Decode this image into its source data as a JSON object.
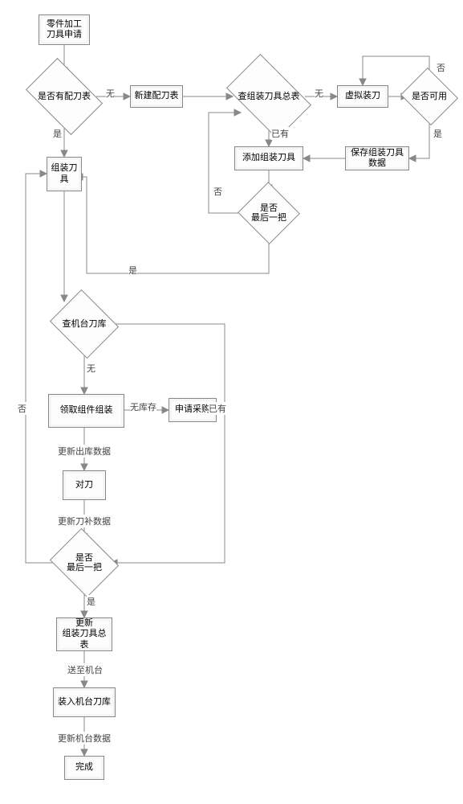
{
  "chart_data": {
    "type": "flowchart",
    "title": "",
    "nodes": [
      {
        "id": "n1",
        "type": "process",
        "label": "零件加工\n刀具申请"
      },
      {
        "id": "d1",
        "type": "decision",
        "label": "是否有配刀表"
      },
      {
        "id": "n2",
        "type": "process",
        "label": "新建配刀表"
      },
      {
        "id": "d2",
        "type": "decision",
        "label": "查组装刀具总表"
      },
      {
        "id": "n3",
        "type": "process",
        "label": "虚拟装刀"
      },
      {
        "id": "d3",
        "type": "decision",
        "label": "是否可用"
      },
      {
        "id": "n4",
        "type": "process",
        "label": "添加组装刀具"
      },
      {
        "id": "n5",
        "type": "process",
        "label": "保存组装刀具数据"
      },
      {
        "id": "d4",
        "type": "decision",
        "label": "是否\n最后一把"
      },
      {
        "id": "n6",
        "type": "process",
        "label": "组装刀具"
      },
      {
        "id": "d5",
        "type": "decision",
        "label": "查机台刀库"
      },
      {
        "id": "n7",
        "type": "process",
        "label": "领取组件组装"
      },
      {
        "id": "n8",
        "type": "process",
        "label": "申请采购"
      },
      {
        "id": "n9",
        "type": "process",
        "label": "对刀"
      },
      {
        "id": "d6",
        "type": "decision",
        "label": "是否\n最后一把"
      },
      {
        "id": "n10",
        "type": "process",
        "label": "更新\n组装刀具总表"
      },
      {
        "id": "n11",
        "type": "process",
        "label": "装入机台刀库"
      },
      {
        "id": "n12",
        "type": "process",
        "label": "完成"
      }
    ],
    "edges": [
      {
        "from": "n1",
        "to": "d1"
      },
      {
        "from": "d1",
        "to": "n2",
        "label": "无"
      },
      {
        "from": "d1",
        "to": "n6",
        "label": "是"
      },
      {
        "from": "n2",
        "to": "d2"
      },
      {
        "from": "d2",
        "to": "n3",
        "label": "无"
      },
      {
        "from": "d2",
        "to": "n4",
        "label": "已有"
      },
      {
        "from": "n3",
        "to": "d3"
      },
      {
        "from": "d3",
        "to": "n3",
        "label": "否"
      },
      {
        "from": "d3",
        "to": "n5",
        "label": "是"
      },
      {
        "from": "n5",
        "to": "n4"
      },
      {
        "from": "n4",
        "to": "d4"
      },
      {
        "from": "d4",
        "to": "d2",
        "label": "否"
      },
      {
        "from": "d4",
        "to": "n6",
        "label": "是"
      },
      {
        "from": "n6",
        "to": "d5"
      },
      {
        "from": "d5",
        "to": "n7",
        "label": "无"
      },
      {
        "from": "d5",
        "to": "d6",
        "label": "已有"
      },
      {
        "from": "n7",
        "to": "n8",
        "label": "无库存"
      },
      {
        "from": "n7",
        "to": "n9",
        "label": "更新出库数据"
      },
      {
        "from": "n9",
        "to": "d6",
        "label": "更新刀补数据"
      },
      {
        "from": "d6",
        "to": "n6",
        "label": "否"
      },
      {
        "from": "d6",
        "to": "n10",
        "label": "是"
      },
      {
        "from": "n10",
        "to": "n11",
        "label": "送至机台"
      },
      {
        "from": "n11",
        "to": "n12",
        "label": "更新机台数据"
      }
    ]
  },
  "labels": {
    "no": "否",
    "yes": "是",
    "none": "无",
    "exists": "已有",
    "nostock": "无库存",
    "upd_out": "更新出库数据",
    "upd_comp": "更新刀补数据",
    "send": "送至机台",
    "upd_mach": "更新机台数据"
  }
}
